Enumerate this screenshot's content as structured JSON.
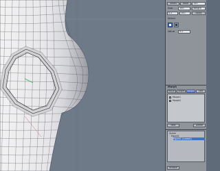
{
  "panel": {
    "top_buttons": [
      "Select",
      "Move"
    ],
    "fields": {
      "size_label": "Size",
      "size_value": "100",
      "mode_value": "Weight",
      "value_label": "Value",
      "value_value": "0.2"
    },
    "tool_checkbox_label": "Select",
    "divider_label": "Morph",
    "list_tabs": [
      "Morph",
      "Target",
      "Weight",
      "Edit"
    ],
    "list_items": [
      "Morph1",
      "Morph2"
    ],
    "actions": [
      "New",
      "Delete",
      "Apply"
    ],
    "scene_items": [
      "Scene",
      "Figure1",
      "Figure1 (current)"
    ],
    "footer_button": "Browse"
  },
  "colors": {
    "accent": "#3a73c7",
    "viewport_bg": "#6e7a88",
    "panel_bg": "#8f949b"
  }
}
